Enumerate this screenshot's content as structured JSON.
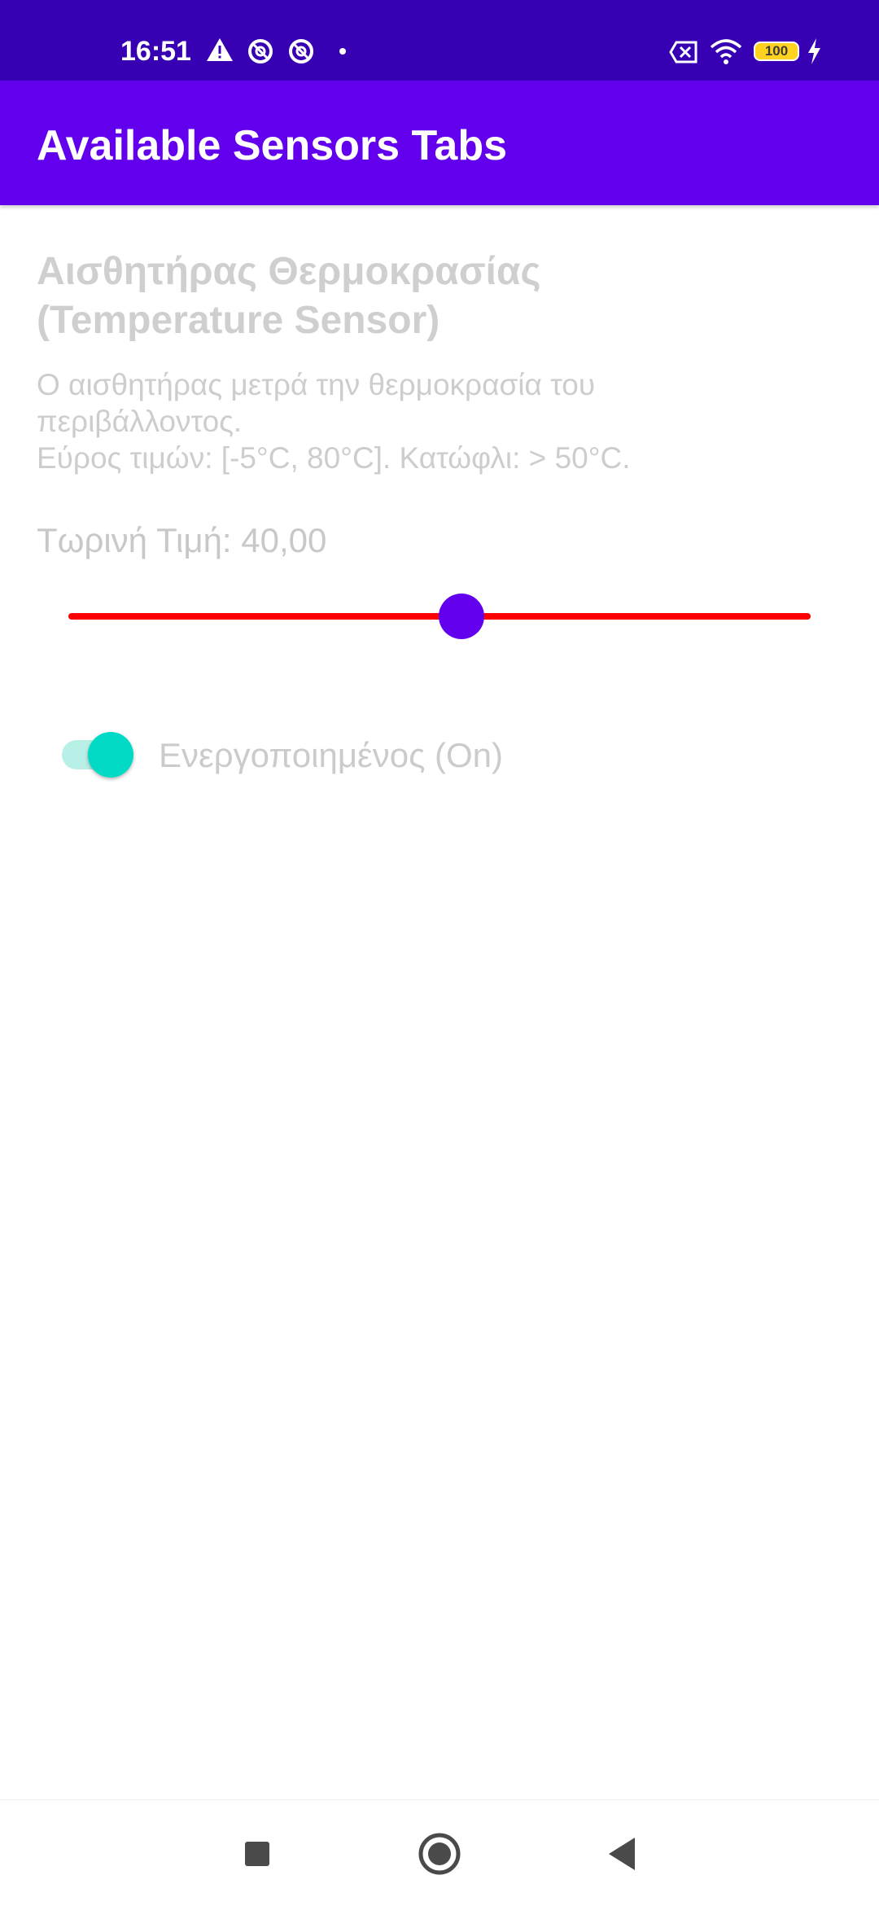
{
  "status_bar": {
    "time": "16:51",
    "battery": "100",
    "left_icons": [
      "warning-icon",
      "sync-icon",
      "sync-icon",
      "dot-icon"
    ],
    "right_icons": [
      "sim-x-icon",
      "wifi-icon",
      "battery-icon",
      "charging-icon"
    ]
  },
  "app_bar": {
    "title": "Available Sensors Tabs"
  },
  "sensor": {
    "title": " Αισθητήρας Θερμοκρασίας (Temperature Sensor)",
    "description": "Ο αισθητήρας μετρά την θερμοκρασία του περιβάλλοντος.\nΕύρος τιμών: [-5°C, 80°C]. Κατώφλι: > 50°C.",
    "current_value": "Τωρινή Τιμή: 40,00",
    "slider": {
      "value": 40,
      "min": -5,
      "max": 80,
      "track_color": "#FF0000",
      "thumb_color": "#6200EE"
    },
    "switch": {
      "label": "Ενεργοποιημένος (On)",
      "checked": true,
      "color": "#03DAC5"
    }
  },
  "nav_bar": {
    "buttons": [
      "recents-icon",
      "home-icon",
      "back-icon"
    ]
  },
  "colors": {
    "status_bar": "#3700B3",
    "app_bar": "#6200EE"
  }
}
